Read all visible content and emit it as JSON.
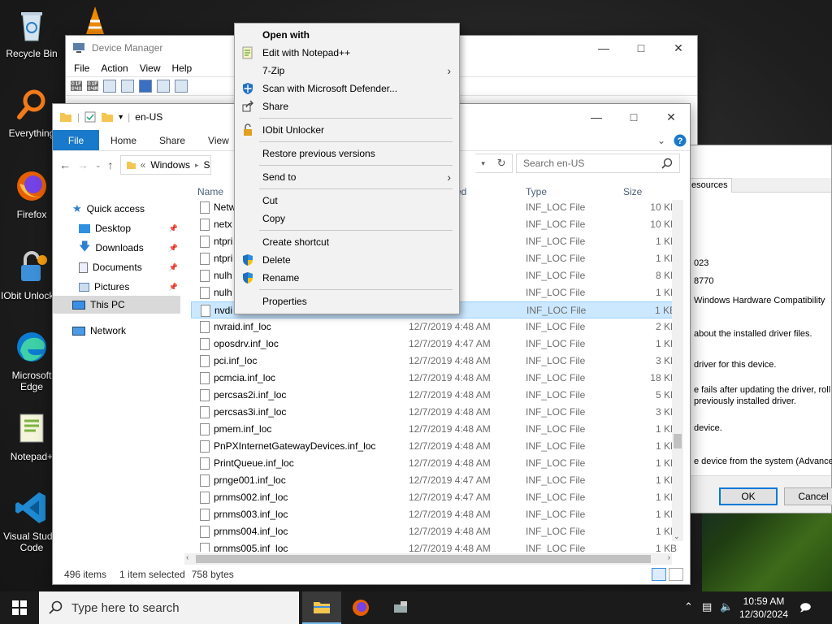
{
  "desktop": {
    "icons": [
      {
        "label": "Recycle Bin"
      },
      {
        "label": "Everything"
      },
      {
        "label": "Firefox"
      },
      {
        "label": "IObit Unlocker"
      },
      {
        "label": "Microsoft Edge"
      },
      {
        "label": "Notepad+"
      },
      {
        "label": "Visual Studio Code"
      }
    ]
  },
  "device_manager": {
    "title": "Device Manager",
    "menu": [
      "File",
      "Action",
      "View",
      "Help"
    ]
  },
  "properties_dialog": {
    "tab_label": "esources",
    "lines": [
      "023",
      "8770",
      "Windows Hardware Compatibility",
      "about the installed driver files.",
      "driver for this device.",
      "e fails after updating the driver, roll",
      "previously installed driver.",
      "device.",
      "e device from the system (Advanced)."
    ],
    "ok": "OK",
    "cancel": "Cancel"
  },
  "explorer": {
    "title": "en-US",
    "ribbon": [
      "File",
      "Home",
      "Share",
      "View"
    ],
    "address": {
      "prefix": "«",
      "segment": "Windows",
      "trail": "S"
    },
    "search_placeholder": "Search en-US",
    "nav": {
      "quick_access": "Quick access",
      "desktop": "Desktop",
      "downloads": "Downloads",
      "documents": "Documents",
      "pictures": "Pictures",
      "this_pc": "This PC",
      "network": "Network"
    },
    "columns": {
      "name": "Name",
      "date": "ed",
      "type": "Type",
      "size": "Size"
    },
    "files": [
      {
        "name": "Netw",
        "date": "4:48 AM",
        "type": "INF_LOC File",
        "size": "10 KB"
      },
      {
        "name": "netx",
        "date": "4:48 AM",
        "type": "INF_LOC File",
        "size": "10 KB"
      },
      {
        "name": "ntpri",
        "date": "4:48 AM",
        "type": "INF_LOC File",
        "size": "1 KB"
      },
      {
        "name": "ntpri",
        "date": "4:48 AM",
        "type": "INF_LOC File",
        "size": "1 KB"
      },
      {
        "name": "nulh",
        "date": "4:48 AM",
        "type": "INF_LOC File",
        "size": "8 KB"
      },
      {
        "name": "nulh",
        "date": "4:48 AM",
        "type": "INF_LOC File",
        "size": "1 KB"
      },
      {
        "name": "nvdi",
        "date": "4:48 AM",
        "type": "INF_LOC File",
        "size": "1 KB"
      },
      {
        "name": "nvraid.inf_loc",
        "date": "12/7/2019 4:48 AM",
        "type": "INF_LOC File",
        "size": "2 KB"
      },
      {
        "name": "oposdrv.inf_loc",
        "date": "12/7/2019 4:47 AM",
        "type": "INF_LOC File",
        "size": "1 KB"
      },
      {
        "name": "pci.inf_loc",
        "date": "12/7/2019 4:48 AM",
        "type": "INF_LOC File",
        "size": "3 KB"
      },
      {
        "name": "pcmcia.inf_loc",
        "date": "12/7/2019 4:48 AM",
        "type": "INF_LOC File",
        "size": "18 KB"
      },
      {
        "name": "percsas2i.inf_loc",
        "date": "12/7/2019 4:48 AM",
        "type": "INF_LOC File",
        "size": "5 KB"
      },
      {
        "name": "percsas3i.inf_loc",
        "date": "12/7/2019 4:48 AM",
        "type": "INF_LOC File",
        "size": "3 KB"
      },
      {
        "name": "pmem.inf_loc",
        "date": "12/7/2019 4:48 AM",
        "type": "INF_LOC File",
        "size": "1 KB"
      },
      {
        "name": "PnPXInternetGatewayDevices.inf_loc",
        "date": "12/7/2019 4:48 AM",
        "type": "INF_LOC File",
        "size": "1 KB"
      },
      {
        "name": "PrintQueue.inf_loc",
        "date": "12/7/2019 4:48 AM",
        "type": "INF_LOC File",
        "size": "1 KB"
      },
      {
        "name": "prnge001.inf_loc",
        "date": "12/7/2019 4:47 AM",
        "type": "INF_LOC File",
        "size": "1 KB"
      },
      {
        "name": "prnms002.inf_loc",
        "date": "12/7/2019 4:47 AM",
        "type": "INF_LOC File",
        "size": "1 KB"
      },
      {
        "name": "prnms003.inf_loc",
        "date": "12/7/2019 4:48 AM",
        "type": "INF_LOC File",
        "size": "1 KB"
      },
      {
        "name": "prnms004.inf_loc",
        "date": "12/7/2019 4:48 AM",
        "type": "INF_LOC File",
        "size": "1 KB"
      },
      {
        "name": "prnms005.inf_loc",
        "date": "12/7/2019 4:48 AM",
        "type": "INF_LOC File",
        "size": "1 KB"
      }
    ],
    "selected_row": 6,
    "status": {
      "count": "496 items",
      "selection": "1 item selected",
      "size": "758 bytes"
    }
  },
  "context_menu": {
    "items": [
      {
        "label": "Open with",
        "bold": true
      },
      {
        "label": "Edit with Notepad++",
        "icon": "notepad-plus-plus-icon"
      },
      {
        "label": "7-Zip",
        "submenu": true
      },
      {
        "label": "Scan with Microsoft Defender...",
        "icon": "defender-shield-icon"
      },
      {
        "label": "Share",
        "icon": "share-icon"
      },
      {
        "label": "IObit Unlocker",
        "icon": "lock-icon"
      },
      {
        "label": "Restore previous versions"
      },
      {
        "label": "Send to",
        "submenu": true
      },
      {
        "label": "Cut"
      },
      {
        "label": "Copy"
      },
      {
        "label": "Create shortcut"
      },
      {
        "label": "Delete",
        "icon": "uac-shield-icon"
      },
      {
        "label": "Rename",
        "icon": "uac-shield-icon"
      },
      {
        "label": "Properties"
      }
    ]
  },
  "taskbar": {
    "search_placeholder": "Type here to search",
    "time": "10:59 AM",
    "date": "12/30/2024"
  },
  "colors": {
    "accent": "#1979ca",
    "selection": "#cce8ff",
    "taskbar": "#1b1b1b"
  }
}
